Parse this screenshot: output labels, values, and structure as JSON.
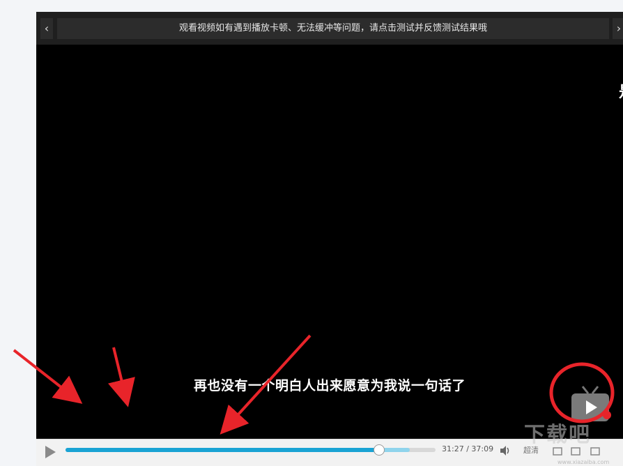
{
  "player": {
    "notice": "观看视频如有遇到播放卡顿、无法缓冲等问题，请点击测试并反馈测试结果哦",
    "prev_label": "‹",
    "next_label": "›",
    "edge_glyph": "是",
    "subtitle": "再也没有一个明白人出来愿意为我说一句话了"
  },
  "controls": {
    "time": "31:27 / 37:09",
    "quality": "超清",
    "progress_played_fraction": 0.8466,
    "progress_buffered_fraction": 0.93
  },
  "watermark": {
    "text": "下载吧",
    "site": "www.xiazaiba.com"
  },
  "colors": {
    "progress_played": "#1aa3d4",
    "progress_buffered": "#8fd4ec",
    "annotation_red": "#e8242a"
  }
}
